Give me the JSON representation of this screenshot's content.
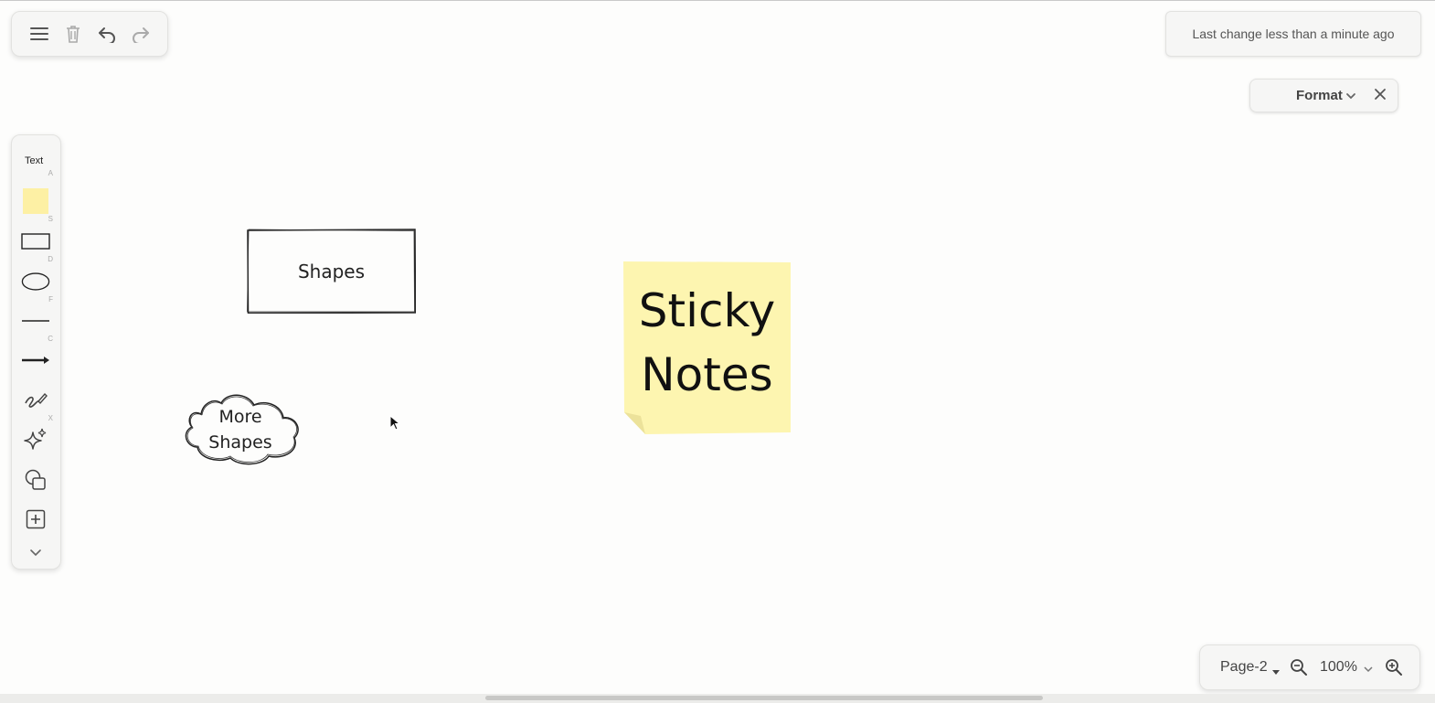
{
  "topbar": {
    "menu_icon": "hamburger-menu-icon",
    "delete_icon": "trash-icon",
    "undo_icon": "undo-icon",
    "redo_icon": "redo-icon"
  },
  "status": {
    "last_change": "Last change less than a minute ago"
  },
  "format_panel": {
    "title": "Format",
    "chevron_icon": "chevron-down-icon",
    "close_icon": "close-icon"
  },
  "toolbox": {
    "text_label": "Text",
    "tools": [
      {
        "name": "text",
        "key": "A"
      },
      {
        "name": "sticky-note",
        "key": "S"
      },
      {
        "name": "rectangle",
        "key": "D"
      },
      {
        "name": "ellipse",
        "key": "F"
      },
      {
        "name": "line",
        "key": "C"
      },
      {
        "name": "arrow",
        "key": ""
      },
      {
        "name": "freehand",
        "key": "X"
      },
      {
        "name": "ai-generate",
        "key": ""
      },
      {
        "name": "shapes",
        "key": ""
      },
      {
        "name": "insert",
        "key": ""
      },
      {
        "name": "more",
        "key": ""
      }
    ]
  },
  "canvas": {
    "rect_label": "Shapes",
    "cloud_line1": "More",
    "cloud_line2": "Shapes",
    "sticky_line1": "Sticky",
    "sticky_line2": "Notes",
    "sticky_color": "#fdf5b0"
  },
  "bottombar": {
    "page": "Page-2",
    "zoom": "100%"
  }
}
